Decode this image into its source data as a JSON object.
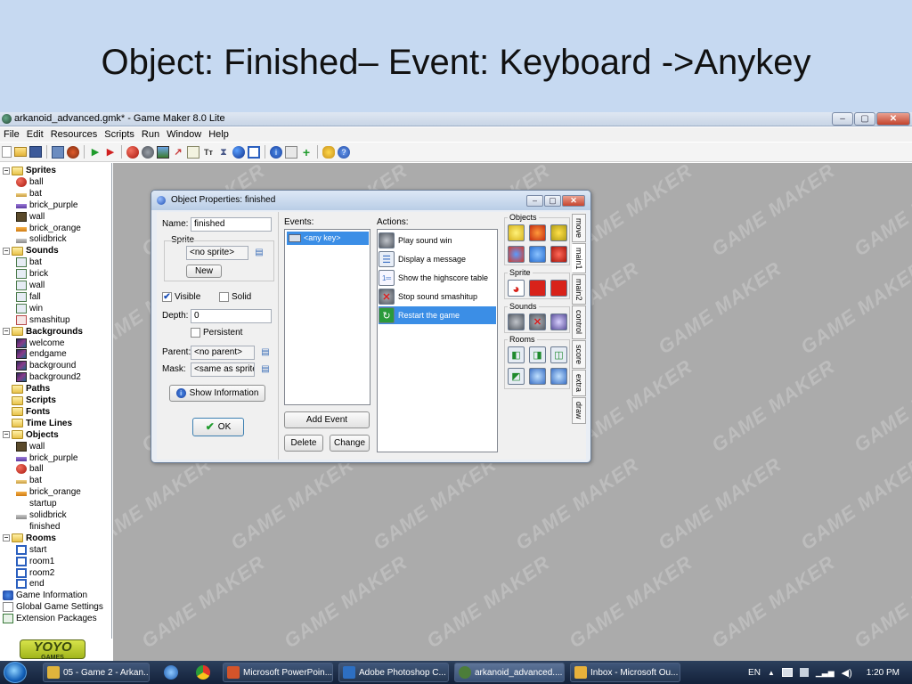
{
  "slide": {
    "title": "Object: Finished– Event: Keyboard ->Anykey"
  },
  "window": {
    "title": "arkanoid_advanced.gmk* - Game Maker 8.0 Lite",
    "minimize": "–",
    "maximize": "▢",
    "close": "✕"
  },
  "menu": [
    "File",
    "Edit",
    "Resources",
    "Scripts",
    "Run",
    "Window",
    "Help"
  ],
  "toolbar_icons": [
    "new-icon",
    "open-icon",
    "save-icon",
    "|",
    "create-executable-icon",
    "publish-icon",
    "|",
    "run-icon",
    "debug-icon",
    "|",
    "add-sprite-icon",
    "add-sound-icon",
    "add-background-icon",
    "add-path-icon",
    "add-script-icon",
    "add-font-icon",
    "add-timeline-icon",
    "add-object-icon",
    "add-room-icon",
    "|",
    "game-information-icon",
    "global-settings-icon",
    "extension-icon",
    "|",
    "manual-icon",
    "help-icon"
  ],
  "tree": {
    "items": [
      {
        "label": "Sprites",
        "type": "folder",
        "level": 0,
        "expanded": true
      },
      {
        "label": "ball",
        "type": "sprite",
        "icon": "red-ball",
        "level": 1
      },
      {
        "label": "bat",
        "type": "sprite",
        "icon": "bat",
        "level": 1
      },
      {
        "label": "brick_purple",
        "type": "sprite",
        "icon": "brick-purple",
        "level": 1
      },
      {
        "label": "wall",
        "type": "sprite",
        "icon": "wall",
        "level": 1
      },
      {
        "label": "brick_orange",
        "type": "sprite",
        "icon": "brick-orange",
        "level": 1
      },
      {
        "label": "solidbrick",
        "type": "sprite",
        "icon": "brick-gray",
        "level": 1
      },
      {
        "label": "Sounds",
        "type": "folder",
        "level": 0,
        "expanded": true
      },
      {
        "label": "bat",
        "type": "sound",
        "icon": "sound",
        "level": 1
      },
      {
        "label": "brick",
        "type": "sound",
        "icon": "sound",
        "level": 1
      },
      {
        "label": "wall",
        "type": "sound",
        "icon": "sound",
        "level": 1
      },
      {
        "label": "fall",
        "type": "sound",
        "icon": "sound",
        "level": 1
      },
      {
        "label": "win",
        "type": "sound",
        "icon": "sound",
        "level": 1
      },
      {
        "label": "smashitup",
        "type": "sound",
        "icon": "sound-red",
        "level": 1
      },
      {
        "label": "Backgrounds",
        "type": "folder",
        "level": 0,
        "expanded": true
      },
      {
        "label": "welcome",
        "type": "background",
        "icon": "bg",
        "level": 1
      },
      {
        "label": "endgame",
        "type": "background",
        "icon": "bg",
        "level": 1
      },
      {
        "label": "background",
        "type": "background",
        "icon": "bg",
        "level": 1
      },
      {
        "label": "background2",
        "type": "background",
        "icon": "bg",
        "level": 1
      },
      {
        "label": "Paths",
        "type": "folder",
        "level": 0
      },
      {
        "label": "Scripts",
        "type": "folder",
        "level": 0
      },
      {
        "label": "Fonts",
        "type": "folder",
        "level": 0
      },
      {
        "label": "Time Lines",
        "type": "folder",
        "level": 0
      },
      {
        "label": "Objects",
        "type": "folder",
        "level": 0,
        "expanded": true
      },
      {
        "label": "wall",
        "type": "object",
        "icon": "wall",
        "level": 1
      },
      {
        "label": "brick_purple",
        "type": "object",
        "icon": "brick-purple",
        "level": 1
      },
      {
        "label": "ball",
        "type": "object",
        "icon": "red-ball",
        "level": 1
      },
      {
        "label": "bat",
        "type": "object",
        "icon": "bat",
        "level": 1
      },
      {
        "label": "brick_orange",
        "type": "object",
        "icon": "brick-orange",
        "level": 1
      },
      {
        "label": "startup",
        "type": "object",
        "icon": "none",
        "level": 1
      },
      {
        "label": "solidbrick",
        "type": "object",
        "icon": "brick-gray",
        "level": 1
      },
      {
        "label": "finished",
        "type": "object",
        "icon": "none",
        "level": 1
      },
      {
        "label": "Rooms",
        "type": "folder",
        "level": 0,
        "expanded": true
      },
      {
        "label": "start",
        "type": "room",
        "icon": "room",
        "level": 1
      },
      {
        "label": "room1",
        "type": "room",
        "icon": "room",
        "level": 1
      },
      {
        "label": "room2",
        "type": "room",
        "icon": "room",
        "level": 1
      },
      {
        "label": "end",
        "type": "room",
        "icon": "room",
        "level": 1
      },
      {
        "label": "Game Information",
        "type": "leaf",
        "icon": "info",
        "level": 0
      },
      {
        "label": "Global Game Settings",
        "type": "leaf",
        "icon": "settings",
        "level": 0
      },
      {
        "label": "Extension Packages",
        "type": "leaf",
        "icon": "extension",
        "level": 0
      }
    ],
    "logo": "YOYO",
    "logo_sub": "GAMES"
  },
  "watermark": "GAME MAKER",
  "dialog": {
    "title": "Object Properties: finished",
    "name_label": "Name:",
    "name_value": "finished",
    "sprite_label": "Sprite",
    "sprite_value": "<no sprite>",
    "new_button": "New",
    "visible_label": "Visible",
    "visible_checked": true,
    "solid_label": "Solid",
    "solid_checked": false,
    "depth_label": "Depth:",
    "depth_value": "0",
    "persistent_label": "Persistent",
    "persistent_checked": false,
    "parent_label": "Parent:",
    "parent_value": "<no parent>",
    "mask_label": "Mask:",
    "mask_value": "<same as sprite>",
    "show_info_button": "Show Information",
    "ok_button": "OK",
    "check_mark": "✔",
    "events_label": "Events:",
    "events": [
      {
        "label": "<any key>",
        "selected": true
      }
    ],
    "add_event_button": "Add Event",
    "delete_button": "Delete",
    "change_button": "Change",
    "actions_label": "Actions:",
    "actions": [
      {
        "label": "Play sound win",
        "icon": "speaker",
        "selected": false
      },
      {
        "label": "Display a message",
        "icon": "message",
        "selected": false
      },
      {
        "label": "Show the highscore table",
        "icon": "highscore",
        "selected": false
      },
      {
        "label": "Stop sound smashitup",
        "icon": "stop-sound",
        "selected": false
      },
      {
        "label": "Restart the game",
        "icon": "restart",
        "selected": true
      }
    ],
    "palette_groups": {
      "objects": "Objects",
      "sprite": "Sprite",
      "sounds": "Sounds",
      "rooms": "Rooms"
    },
    "tabs": [
      "move",
      "main1",
      "main2",
      "control",
      "score",
      "extra",
      "draw"
    ],
    "active_tab": "main1"
  },
  "taskbar": {
    "buttons": [
      {
        "label": "05 - Game 2 - Arkan...",
        "icon_color": "#e0b43c",
        "active": false
      },
      {
        "label": "Microsoft PowerPoin...",
        "icon_color": "#d3542a",
        "active": false
      },
      {
        "label": "Adobe Photoshop C...",
        "icon_color": "#2d6fc2",
        "active": false
      },
      {
        "label": "arkanoid_advanced....",
        "icon_color": "#4c7d3a",
        "active": true
      },
      {
        "label": "Inbox - Microsoft Ou...",
        "icon_color": "#e7b13b",
        "active": false
      }
    ],
    "language": "EN",
    "time": "1:20 PM"
  },
  "colors": {
    "selection": "#3b8ee6",
    "workspace": "#ababab",
    "slide_bg": "#c6d9f1"
  }
}
